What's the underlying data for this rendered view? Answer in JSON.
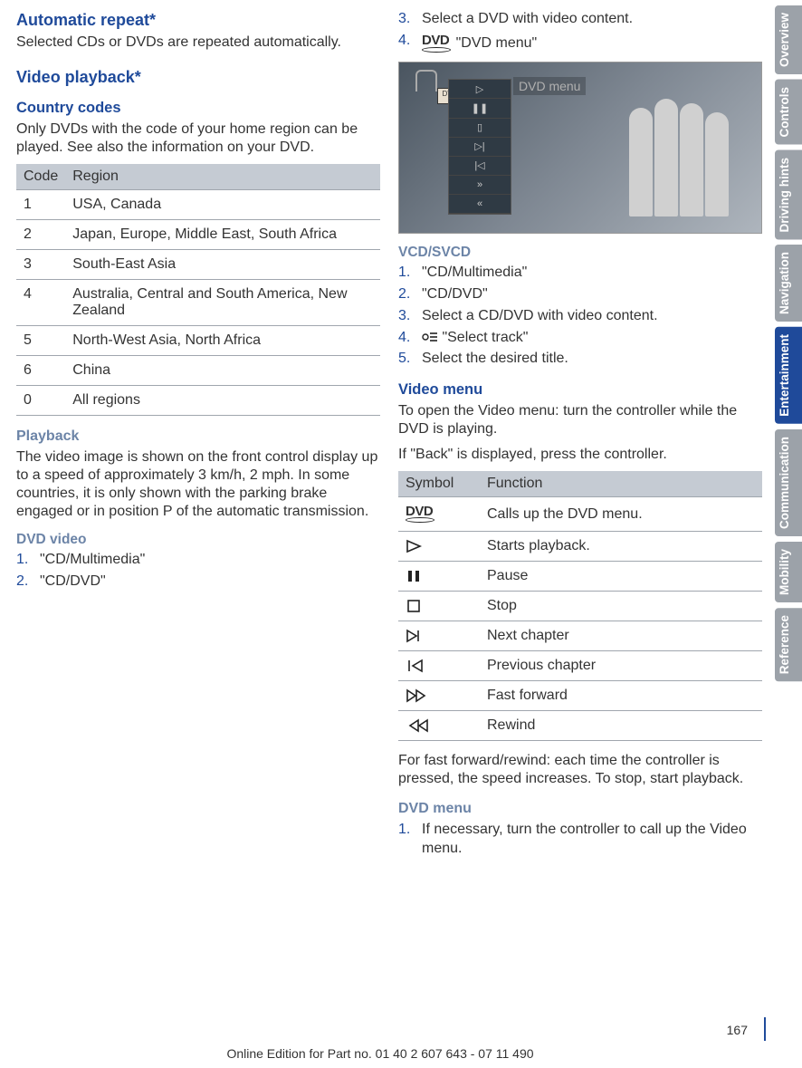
{
  "left": {
    "h1": "Automatic repeat*",
    "p1": "Selected CDs or DVDs are repeated automatically.",
    "h2": "Video playback*",
    "h3": "Country codes",
    "p2": "Only DVDs with the code of your home region can be played. See also the information on your DVD.",
    "table": {
      "hCode": "Code",
      "hRegion": "Region",
      "rows": [
        {
          "c": "1",
          "r": "USA, Canada"
        },
        {
          "c": "2",
          "r": "Japan, Europe, Middle East, South Africa"
        },
        {
          "c": "3",
          "r": "South-East Asia"
        },
        {
          "c": "4",
          "r": "Australia, Central and South America, New Zealand"
        },
        {
          "c": "5",
          "r": "North-West Asia, North Africa"
        },
        {
          "c": "6",
          "r": "China"
        },
        {
          "c": "0",
          "r": "All regions"
        }
      ]
    },
    "h4": "Playback",
    "p3": "The video image is shown on the front control display up to a speed of approximately 3 km/h, 2 mph. In some countries, it is only shown with the parking brake engaged or in position P of the automatic transmission.",
    "h5": "DVD video",
    "steps1": [
      "\"CD/Multimedia\"",
      "\"CD/DVD\""
    ]
  },
  "right": {
    "steps2": [
      "Select a DVD with video content.",
      "\"DVD menu\""
    ],
    "imgLabel": "DVD menu",
    "imgCallout": "DVD",
    "h5a": "VCD/SVCD",
    "steps3": [
      "\"CD/Multimedia\"",
      "\"CD/DVD\"",
      "Select a CD/DVD with video content.",
      "\"Select track\"",
      "Select the desired title."
    ],
    "h3a": "Video menu",
    "p4": "To open the Video menu: turn the controller while the DVD is playing.",
    "p5": "If \"Back\" is displayed, press the controller.",
    "funcTable": {
      "hSym": "Symbol",
      "hFunc": "Function",
      "rows": [
        {
          "f": "Calls up the DVD menu."
        },
        {
          "f": "Starts playback."
        },
        {
          "f": "Pause"
        },
        {
          "f": "Stop"
        },
        {
          "f": "Next chapter"
        },
        {
          "f": "Previous chapter"
        },
        {
          "f": "Fast forward"
        },
        {
          "f": "Rewind"
        }
      ]
    },
    "p6": "For fast forward/rewind: each time the controller is pressed, the speed increases. To stop, start playback.",
    "h4a": "DVD menu",
    "steps4": [
      "If necessary, turn the controller to call up the Video menu."
    ]
  },
  "tabs": [
    "Overview",
    "Controls",
    "Driving hints",
    "Navigation",
    "Entertainment",
    "Communication",
    "Mobility",
    "Reference"
  ],
  "activeTab": 4,
  "pageNumber": "167",
  "footer": "Online Edition for Part no. 01 40 2 607 643 - 07 11 490"
}
